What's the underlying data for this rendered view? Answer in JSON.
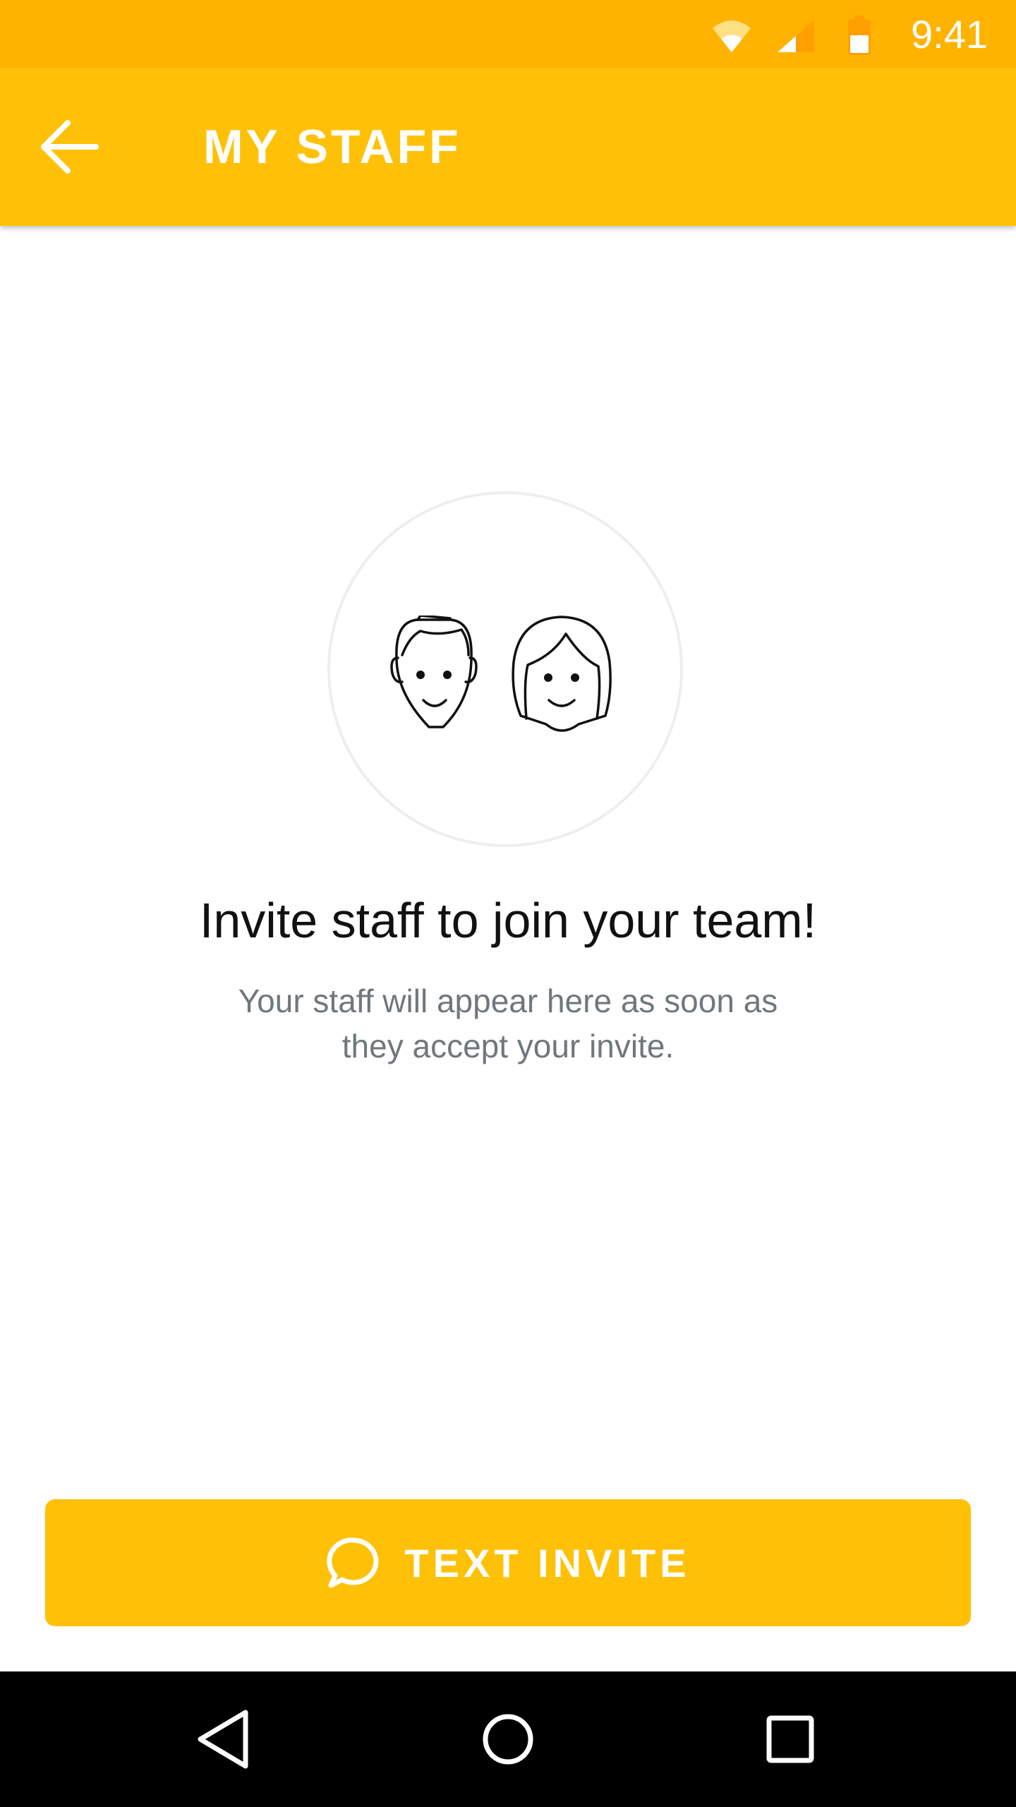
{
  "status_bar": {
    "time": "9:41",
    "icons": [
      "wifi-icon",
      "cell-signal-icon",
      "battery-icon"
    ],
    "color": "#FFB300"
  },
  "app_bar": {
    "title": "MY STAFF",
    "back_icon": "arrow-back-icon",
    "color": "#FFC107"
  },
  "empty_state": {
    "illustration_icon": "staff-faces-icon",
    "title": "Invite staff to join your team!",
    "subtitle": "Your staff will appear here as soon as they accept your invite."
  },
  "cta": {
    "label": "TEXT INVITE",
    "icon": "chat-bubble-icon",
    "color": "#FFC107"
  },
  "nav_bar": {
    "buttons": [
      "back-triangle-icon",
      "home-circle-icon",
      "recents-square-icon"
    ]
  }
}
